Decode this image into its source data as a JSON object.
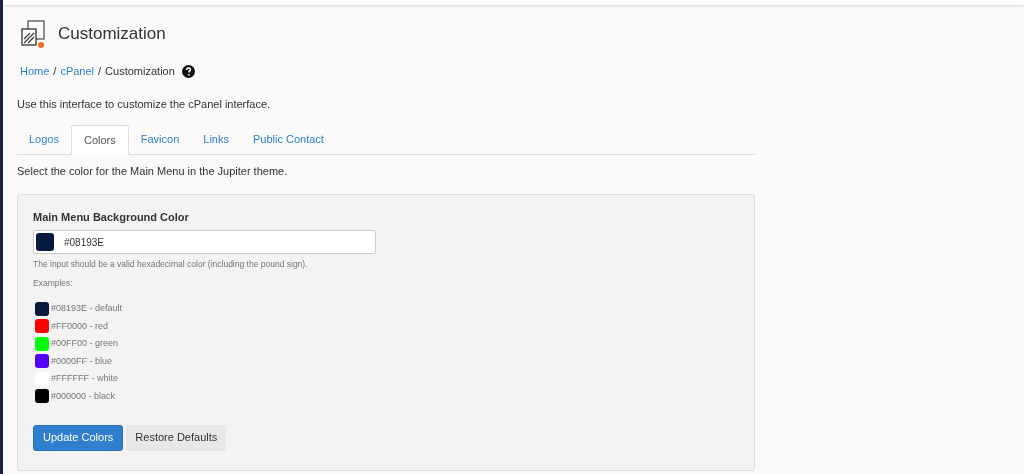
{
  "page": {
    "title": "Customization"
  },
  "breadcrumb": [
    {
      "label": "Home",
      "kind": "link"
    },
    {
      "label": "/",
      "kind": "separator"
    },
    {
      "label": "cPanel",
      "kind": "link"
    },
    {
      "label": "/",
      "kind": "separator"
    },
    {
      "label": "Customization",
      "kind": "current"
    }
  ],
  "description": "Use this interface to customize the cPanel interface.",
  "tabs": [
    {
      "label": "Logos",
      "selected": false
    },
    {
      "label": "Colors",
      "selected": true
    },
    {
      "label": "Favicon",
      "selected": false
    },
    {
      "label": "Links",
      "selected": false
    },
    {
      "label": "Public Contact",
      "selected": false
    }
  ],
  "tab_intro": "Select the color for the Main Menu in the Jupiter theme.",
  "panel": {
    "field_label": "Main Menu Background Color",
    "field": {
      "value": "#08193E",
      "color": "#08193e"
    },
    "help": "The input should be a valid hexadecimal color (including the pound sign).",
    "examples_label": "Examples:",
    "examples": [
      {
        "text": "#08193E - default",
        "color": "#08193e"
      },
      {
        "text": "#FF0000 - red",
        "color": "#ff0000"
      },
      {
        "text": "#00FF00 - green",
        "color": "#00ff00"
      },
      {
        "text": "#0000FF - blue",
        "color": "#5500ff"
      },
      {
        "text": "#FFFFFF - white",
        "color": "#ffffff"
      },
      {
        "text": "#000000 - black",
        "color": "#000000"
      }
    ],
    "buttons": [
      {
        "label": "Update Colors",
        "kind": "primary"
      },
      {
        "label": "Restore Defaults",
        "kind": "secondary"
      }
    ]
  }
}
